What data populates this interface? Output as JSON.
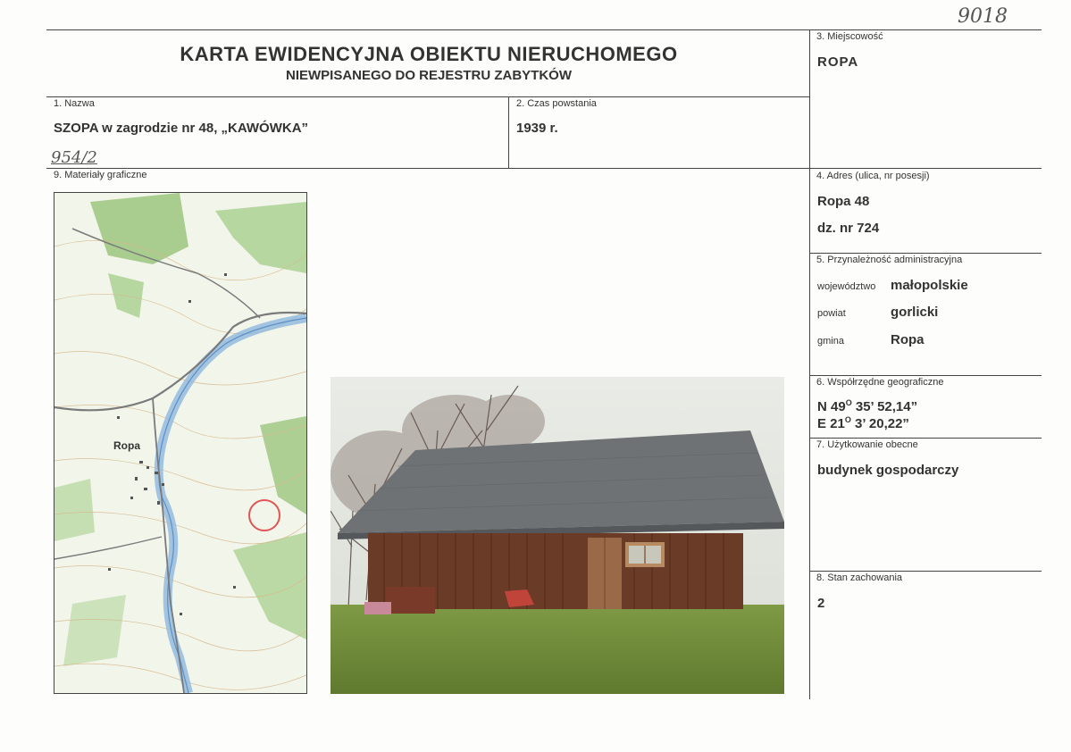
{
  "header": {
    "title_main": "KARTA EWIDENCYJNA OBIEKTU NIERUCHOMEGO",
    "title_sub": "NIEWPISANEGO DO REJESTRU ZABYTKÓW",
    "handwritten_top": "9018",
    "handwritten_left": "954/2"
  },
  "fields": {
    "f1_label": "1. Nazwa",
    "f1_value": "SZOPA w zagrodzie nr 48, „KAWÓWKA”",
    "f2_label": "2. Czas powstania",
    "f2_value": "1939 r.",
    "f3_label": "3. Miejscowość",
    "f3_value": "ROPA",
    "f4_label": "4. Adres (ulica, nr posesji)",
    "f4_value1": "Ropa 48",
    "f4_value2": "dz. nr 724",
    "f5_label": "5. Przynależność administracyjna",
    "f5_woj_label": "województwo",
    "f5_woj_value": "małopolskie",
    "f5_powiat_label": "powiat",
    "f5_powiat_value": "gorlicki",
    "f5_gmina_label": "gmina",
    "f5_gmina_value": "Ropa",
    "f6_label": "6. Współrzędne geograficzne",
    "f6_n_prefix": "N 49",
    "f6_n_deg": "O",
    "f6_n_rest": " 35’ 52,14”",
    "f6_e_prefix": "E 21",
    "f6_e_deg": "O",
    "f6_e_rest": " 3’ 20,22”",
    "f7_label": "7. Użytkowanie obecne",
    "f7_value": "budynek gospodarczy",
    "f8_label": "8. Stan zachowania",
    "f8_value": "2",
    "f9_label": "9. Materiały graficzne"
  },
  "map": {
    "town_label": "Ropa"
  }
}
